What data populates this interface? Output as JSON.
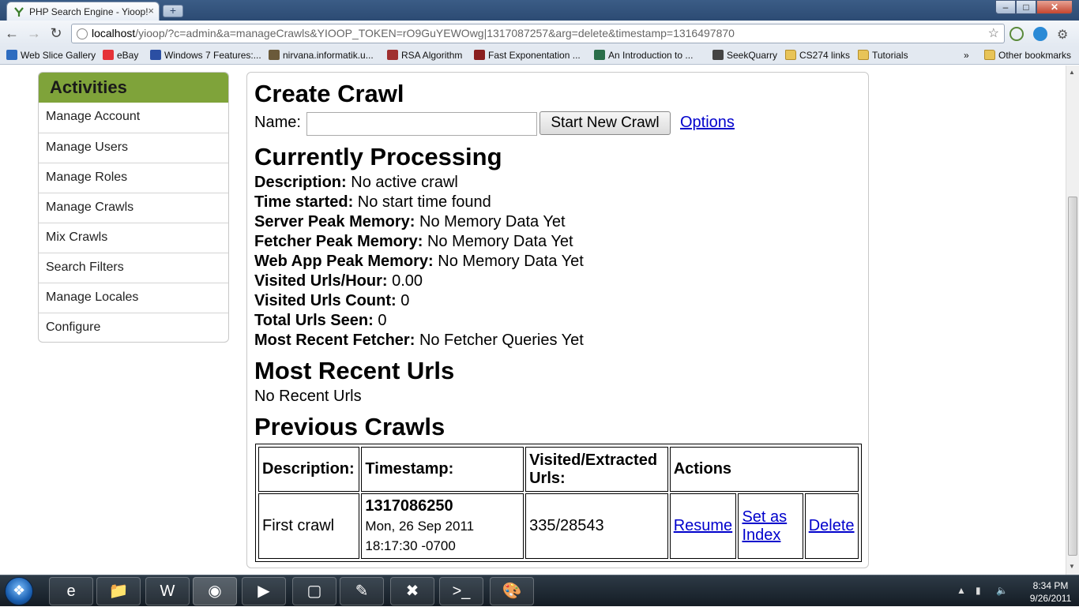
{
  "browser": {
    "tab_title": "PHP Search Engine - Yioop!",
    "tab_close": "×",
    "new_tab": "+",
    "url_host": "localhost",
    "url_rest": "/yioop/?c=admin&a=manageCrawls&YIOOP_TOKEN=rO9GuYEWOwg|1317087257&arg=delete&timestamp=1316497870",
    "bookmarks": [
      {
        "label": "Web Slice Gallery",
        "icon": "web-slice-icon"
      },
      {
        "label": "eBay",
        "icon": "ebay-icon"
      },
      {
        "label": "Windows 7 Features:...",
        "icon": "page-icon"
      },
      {
        "label": "nirvana.informatik.u...",
        "icon": "page-icon"
      },
      {
        "label": "RSA Algorithm",
        "icon": "page-icon"
      },
      {
        "label": "Fast Exponentation ...",
        "icon": "page-icon"
      },
      {
        "label": "An Introduction to ...",
        "icon": "page-icon"
      },
      {
        "label": "SeekQuarry",
        "icon": "page-icon"
      },
      {
        "label": "CS274 links",
        "icon": "folder-icon"
      },
      {
        "label": "Tutorials",
        "icon": "folder-icon"
      }
    ],
    "bookmarks_overflow": "»",
    "other_bookmarks": "Other bookmarks"
  },
  "sidebar": {
    "title": "Activities",
    "items": [
      {
        "label": "Manage Account"
      },
      {
        "label": "Manage Users"
      },
      {
        "label": "Manage Roles"
      },
      {
        "label": "Manage Crawls"
      },
      {
        "label": "Mix Crawls"
      },
      {
        "label": "Search Filters"
      },
      {
        "label": "Manage Locales"
      },
      {
        "label": "Configure"
      }
    ]
  },
  "create": {
    "heading": "Create Crawl",
    "name_label": "Name:",
    "name_value": "",
    "start_button": "Start New Crawl",
    "options_link": "Options"
  },
  "processing": {
    "heading": "Currently Processing",
    "stats": [
      {
        "key": "Description:",
        "value": "No active crawl"
      },
      {
        "key": "Time started:",
        "value": "No start time found"
      },
      {
        "key": "Server Peak Memory:",
        "value": "No Memory Data Yet"
      },
      {
        "key": "Fetcher Peak Memory:",
        "value": "No Memory Data Yet"
      },
      {
        "key": "Web App Peak Memory:",
        "value": "No Memory Data Yet"
      },
      {
        "key": "Visited Urls/Hour:",
        "value": "0.00"
      },
      {
        "key": "Visited Urls Count:",
        "value": "0"
      },
      {
        "key": "Total Urls Seen:",
        "value": "0"
      },
      {
        "key": "Most Recent Fetcher:",
        "value": "No Fetcher Queries Yet"
      }
    ]
  },
  "recent": {
    "heading": "Most Recent Urls",
    "empty_text": "No Recent Urls"
  },
  "previous": {
    "heading": "Previous Crawls",
    "columns": [
      "Description:",
      "Timestamp:",
      "Visited/Extracted Urls:",
      "Actions"
    ],
    "rows": [
      {
        "description": "First crawl",
        "timestamp": "1317086250",
        "date_line1": "Mon, 26 Sep 2011",
        "date_line2": "18:17:30 -0700",
        "urls": "335/28543",
        "actions": [
          "Resume",
          "Set as Index",
          "Delete"
        ]
      }
    ]
  },
  "taskbar": {
    "clock_time": "8:34 PM",
    "clock_date": "9/26/2011"
  }
}
